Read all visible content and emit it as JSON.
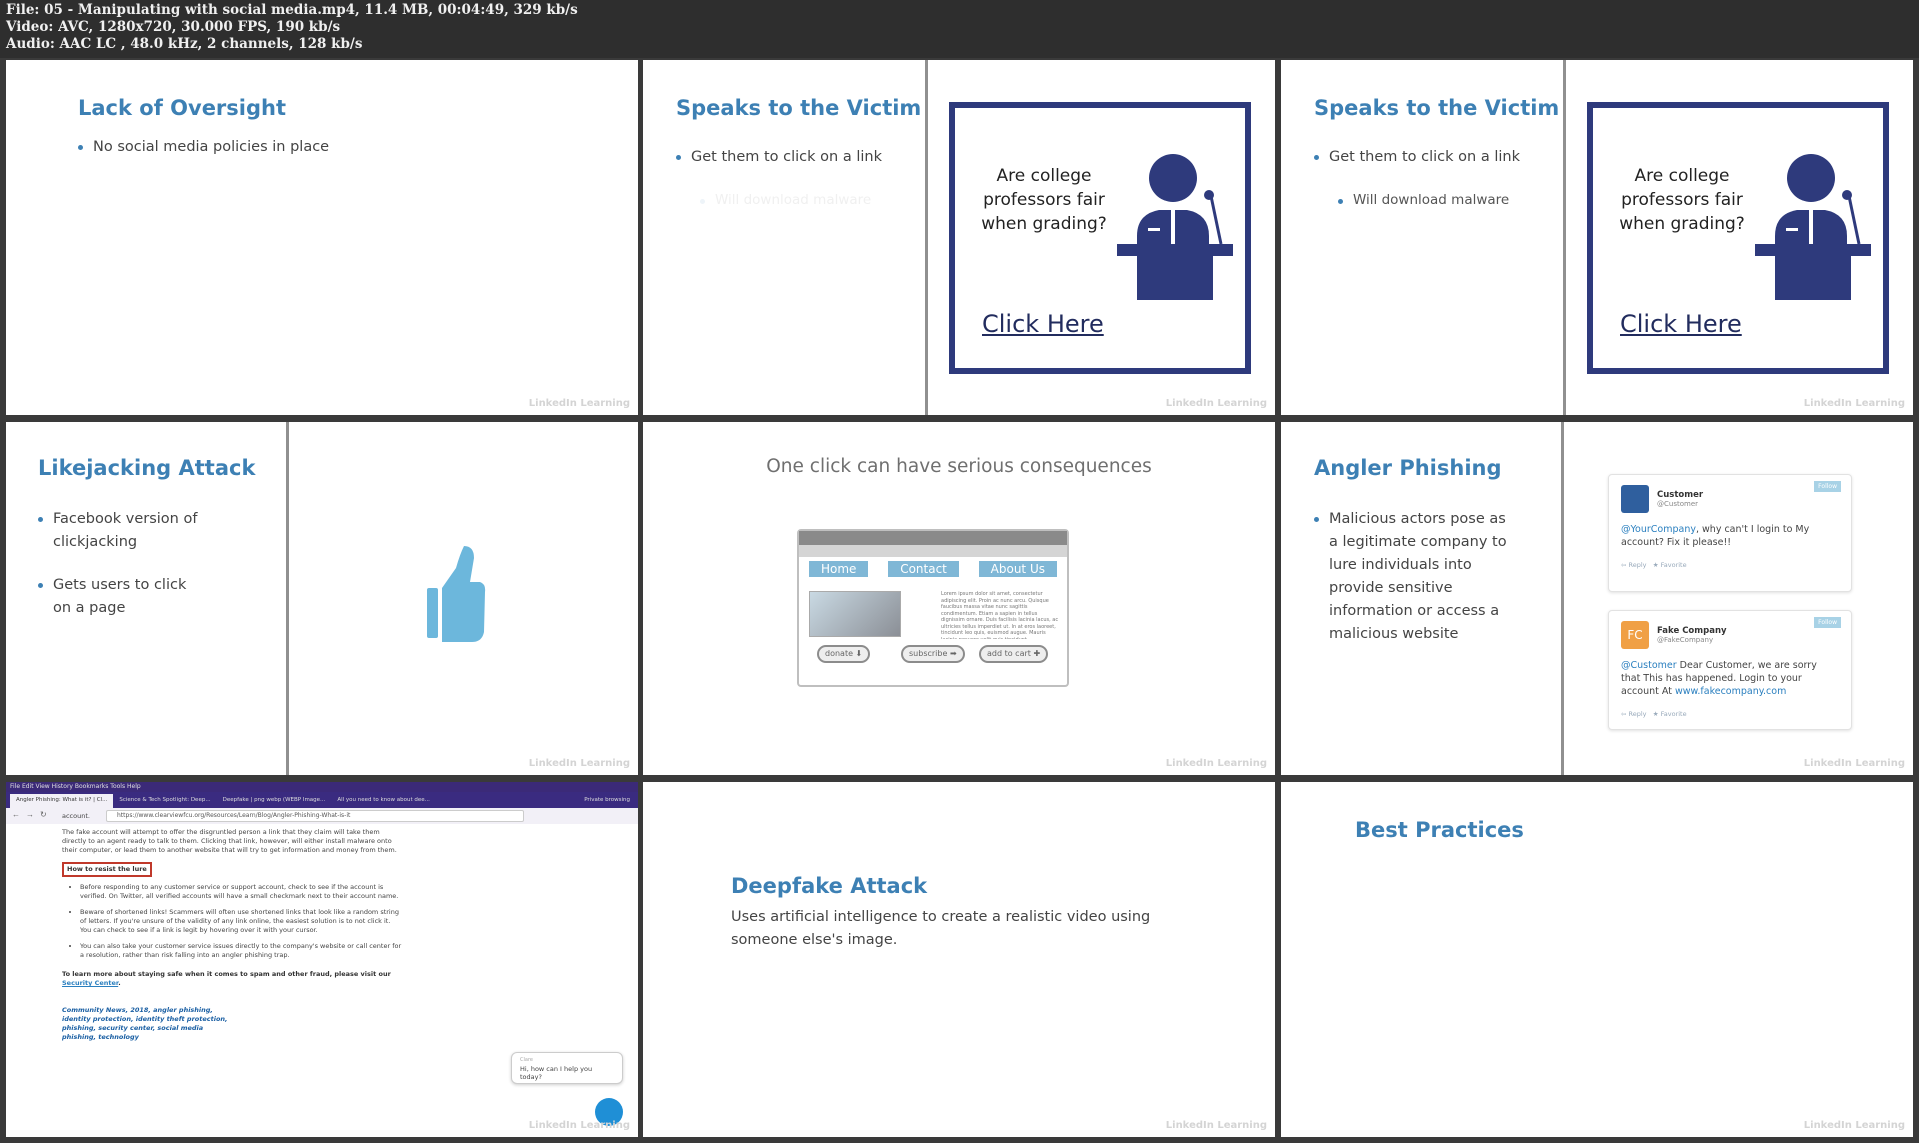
{
  "file_info": {
    "file_line": "File: 05 - Manipulating with social media.mp4, 11.4 MB, 00:04:49, 329 kb/s",
    "video_line": "Video: AVC, 1280x720, 30.000 FPS, 190 kb/s",
    "audio_line": "Audio: AAC LC , 48.0 kHz, 2 channels, 128 kb/s"
  },
  "watermark": "LinkedIn Learning",
  "tile1": {
    "title": "Lack of Oversight",
    "bullets": [
      "No social media policies in place"
    ]
  },
  "tile2": {
    "title": "Speaks to the Victim",
    "bullet": "Get them to click on a link",
    "sub_faded": "Will download malware",
    "poster_question": "Are college professors fair when grading?",
    "poster_link": "Click Here"
  },
  "tile3": {
    "title": "Speaks to the Victim",
    "bullet": "Get them to click on a link",
    "sub": "Will download malware",
    "poster_question": "Are college professors fair when grading?",
    "poster_link": "Click Here"
  },
  "tile4": {
    "title": "Likejacking Attack",
    "bullets": [
      "Facebook version of clickjacking",
      "Gets users to click on a page"
    ]
  },
  "tile5": {
    "heading": "One click can have serious consequences",
    "nav": [
      "Home",
      "Contact",
      "About Us"
    ],
    "lorem": "Lorem ipsum dolor sit amet, consectetur adipiscing elit. Proin ac nunc arcu. Quisque faucibus massa vitae nunc sagittis condimentum. Etiam a sapien in tellus dignissim ornare. Duis facilisis lacinia lacus, ac ultricies tellus imperdiet ut. In at eros laoreet, tincidunt leo quis, euismod augue. Mauris lacinia posuere velit quis tincidunt.",
    "buttons": [
      "donate",
      "subscribe",
      "add to cart"
    ]
  },
  "tile6": {
    "title": "Angler Phishing",
    "bullet": "Malicious actors pose as a legitimate company to lure individuals into provide sensitive information or access a malicious website",
    "tweet1": {
      "name": "Customer",
      "handle": "@Customer",
      "mention": "@YourCompany",
      "text": ", why can't I login to My account? Fix it please!!",
      "follow": "Follow",
      "reply": "Reply",
      "fav": "Favorite"
    },
    "tweet2": {
      "avatar": "FC",
      "name": "Fake Company",
      "handle": "@FakeCompany",
      "mention": "@Customer",
      "text": " Dear Customer, we are sorry that This has happened. Login to your account At ",
      "url": "www.fakecompany.com",
      "follow": "Follow",
      "reply": "Reply",
      "fav": "Favorite"
    }
  },
  "tile7": {
    "menu": "File  Edit  View  History  Bookmarks  Tools  Help",
    "tabs": [
      "Angler Phishing: What is it? | Cl...",
      "Science & Tech Spotlight: Deep...",
      "Deepfake | png webp (WEBP Image...",
      "All you need to know about dee..."
    ],
    "private": "Private browsing",
    "url": "https://www.clearviewfcu.org/Resources/Learn/Blog/Angler-Phishing-What-is-it",
    "para0": "account.",
    "para1": "The fake account will attempt to offer the disgruntled person a link that they claim will take them directly to an agent ready to talk to them. Clicking that link, however, will either install malware onto their computer, or lead them to another website that will try to get information and money from them.",
    "resist": "How to resist the lure",
    "items": [
      "Before responding to any customer service or support account, check to see if the account is verified. On Twitter, all verified accounts will have a small checkmark next to their account name.",
      "Beware of shortened links! Scammers will often use shortened links that look like a random string of letters. If you're unsure of the validity of any link online, the easiest solution is to not click it. You can check to see if a link is legit by hovering over it with your cursor.",
      "You can also take your customer service issues directly to the company's website or call center for a resolution, rather than risk falling into an angler phishing trap."
    ],
    "learn_more": "To learn more about staying safe when it comes to spam and other fraud, please visit our",
    "security_link": "Security Center",
    "tags": "Community News, 2018, angler phishing, identity protection, identity theft protection, phishing, security center, social media phishing, technology",
    "chat_label": "Clare",
    "chat_text": "Hi, how can I help you today?"
  },
  "tile8": {
    "title": "Deepfake Attack",
    "text": "Uses artificial intelligence to create a realistic video using someone else's image."
  },
  "tile9": {
    "title": "Best Practices"
  },
  "colors": {
    "accent": "#3d80b4",
    "navy": "#2e3a7c",
    "thumb": "#6cb7dc"
  }
}
